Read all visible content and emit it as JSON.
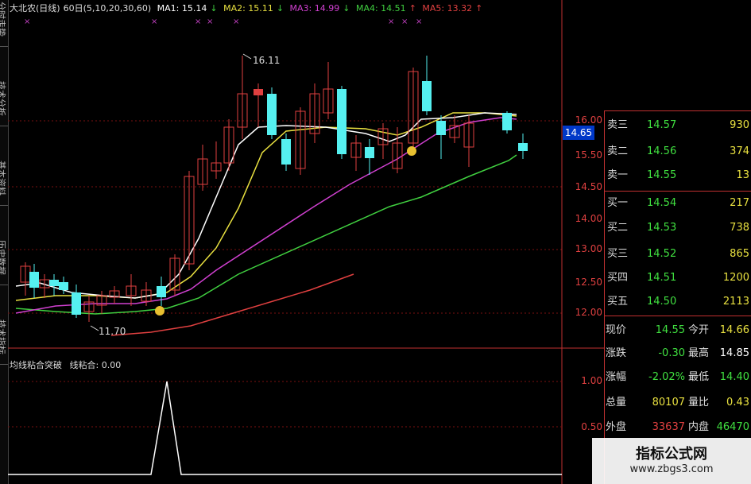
{
  "header": {
    "title": "大北农(日线)",
    "params": "60日(5,10,20,30,60)",
    "ma1": "MA1: 15.14",
    "ma2": "MA2: 15.11",
    "ma3": "MA3: 14.99",
    "ma4": "MA4: 14.51",
    "ma5": "MA5: 13.32",
    "ma1_arrow": "↓",
    "ma2_arrow": "↓",
    "ma3_arrow": "↓",
    "ma4_arrow": "↑",
    "ma5_arrow": "↑",
    "colors": {
      "ma1": "#ffffff",
      "ma2": "#e8e040",
      "ma3": "#d040d0",
      "ma4": "#40d040",
      "ma5": "#e04040"
    }
  },
  "left_tabs": [
    "分时走势",
    "技术分析",
    "基本资料",
    "历史数据",
    "技术指标"
  ],
  "chart_labels": {
    "high_label": "16.11",
    "low_label": "11.70"
  },
  "price_axis": [
    "16.00",
    "15.50",
    "15.00",
    "14.50",
    "14.00",
    "13.50",
    "13.00",
    "12.50",
    "12.00"
  ],
  "current_price_badge": "14.65",
  "indicator": {
    "label": "均线粘合突破",
    "value_text": "线粘合: 0.00",
    "axis": [
      "1.00",
      "0.50"
    ]
  },
  "order_book": {
    "asks": [
      {
        "name": "卖三",
        "price": "14.57",
        "vol": "930"
      },
      {
        "name": "卖二",
        "price": "14.56",
        "vol": "374"
      },
      {
        "name": "卖一",
        "price": "14.55",
        "vol": "13"
      }
    ],
    "bids": [
      {
        "name": "买一",
        "price": "14.54",
        "vol": "217"
      },
      {
        "name": "买二",
        "price": "14.53",
        "vol": "738"
      },
      {
        "name": "买三",
        "price": "14.52",
        "vol": "865"
      },
      {
        "name": "买四",
        "price": "14.51",
        "vol": "1200"
      },
      {
        "name": "买五",
        "price": "14.50",
        "vol": "2113"
      }
    ]
  },
  "quote": [
    {
      "n1": "现价",
      "v1": "14.55",
      "n2": "今开",
      "v2": "14.66"
    },
    {
      "n1": "涨跌",
      "v1": "-0.30",
      "n2": "最高",
      "v2": "14.85"
    },
    {
      "n1": "涨幅",
      "v1": "-2.02%",
      "n2": "最低",
      "v2": "14.40"
    },
    {
      "n1": "总量",
      "v1": "80107",
      "n2": "量比",
      "v2": "0.43"
    },
    {
      "n1": "外盘",
      "v1": "33637",
      "n2": "内盘",
      "v2": "46470"
    }
  ],
  "watermark": {
    "title": "指标公式网",
    "url": "www.zbgs3.com"
  }
}
